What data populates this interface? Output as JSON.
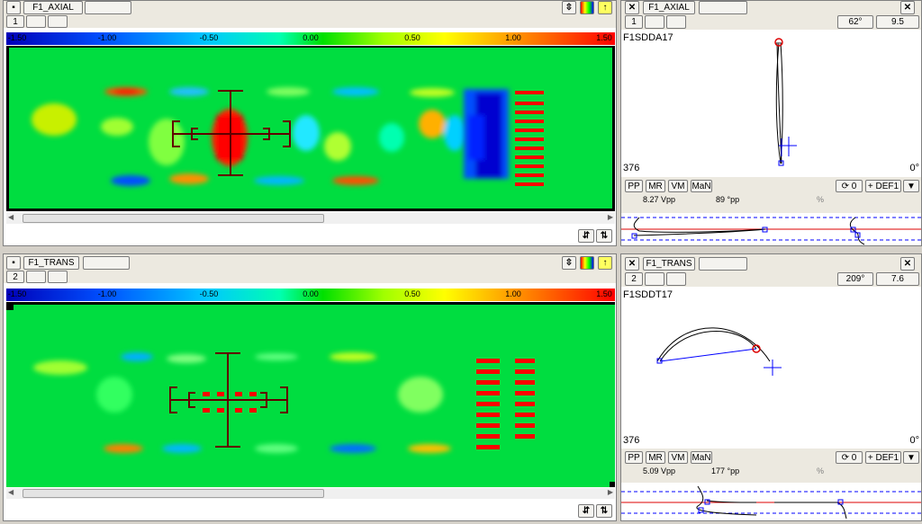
{
  "scale_ticks": [
    "-1.50",
    "-1.00",
    "-0.50",
    "0.00",
    "0.50",
    "1.00",
    "1.50"
  ],
  "top_left": {
    "tab": "F1_AXIAL",
    "index": "1"
  },
  "bottom_left": {
    "tab": "F1_TRANS",
    "index": "2"
  },
  "top_right": {
    "tab": "F1_AXIAL",
    "index": "1",
    "angle": "62°",
    "value": "9.5",
    "channel": "F1SDDA17",
    "count": "376",
    "zero_angle": "0°",
    "modes": [
      "PP",
      "MR",
      "VM",
      "MaN"
    ],
    "rotate_label": "⟳ 0",
    "def_label": "+ DEF1",
    "vpp": "8.27 Vpp",
    "angle_pp": "89 °pp",
    "percent": "%"
  },
  "bottom_right": {
    "tab": "F1_TRANS",
    "index": "2",
    "angle": "209°",
    "value": "7.6",
    "channel": "F1SDDT17",
    "count": "376",
    "zero_angle": "0°",
    "modes": [
      "PP",
      "MR",
      "VM",
      "MaN"
    ],
    "rotate_label": "⟳ 0",
    "def_label": "+ DEF1",
    "vpp": "5.09 Vpp",
    "angle_pp": "177 °pp",
    "percent": "%"
  },
  "icons": {
    "close": "close-icon",
    "window": "window-icon",
    "palette": "palette-icon",
    "cursor": "cursor-arrow-icon",
    "zoom": "zoom-icon"
  },
  "colors": {
    "background": "#00dd40",
    "trace": "#000000",
    "cursor": "#ff0000",
    "baseline": "#0000ff"
  }
}
